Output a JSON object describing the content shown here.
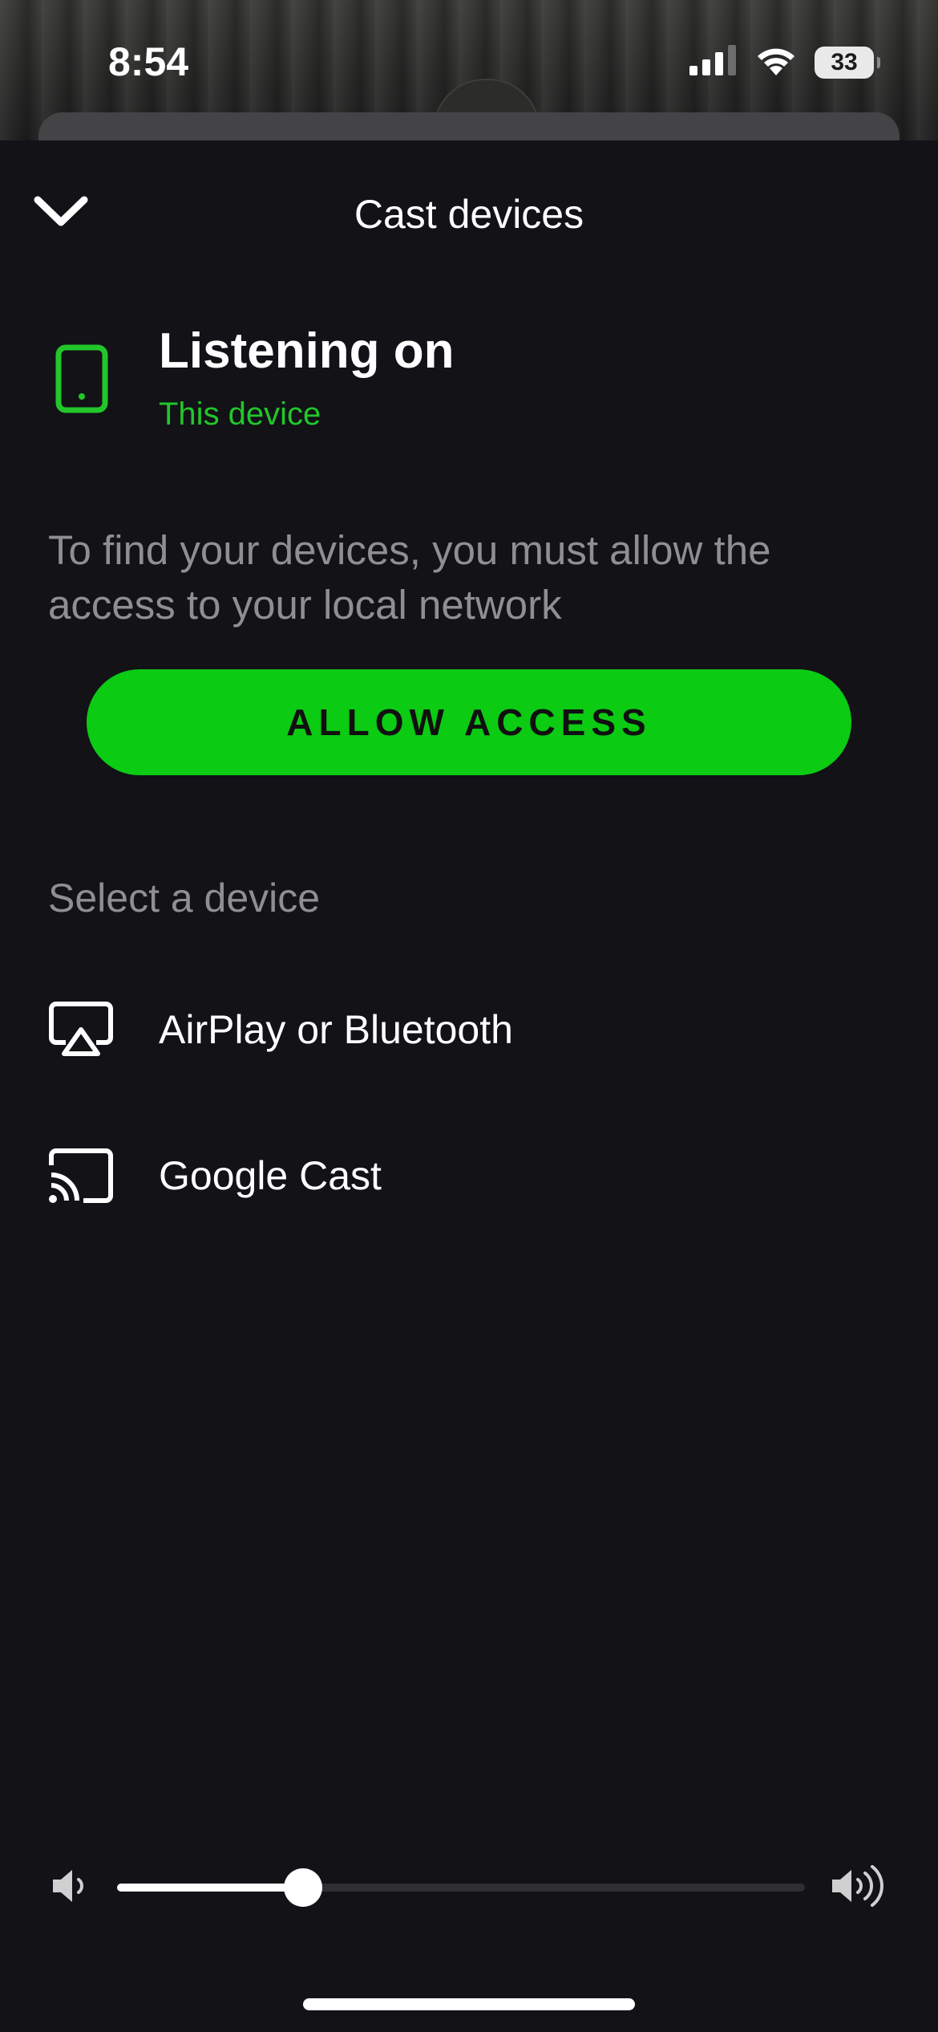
{
  "status_bar": {
    "time": "8:54",
    "battery": "33",
    "icons": [
      "cellular-signal-icon",
      "wifi-icon",
      "battery-icon"
    ]
  },
  "sheet": {
    "title": "Cast devices",
    "close_icon": "chevron-down-icon"
  },
  "current_device": {
    "title": "Listening on",
    "subtitle": "This device",
    "icon": "phone-icon",
    "accent_color": "#1ed760"
  },
  "local_network": {
    "message": "To find your devices, you must allow the access to your local network",
    "button_label": "ALLOW ACCESS",
    "button_color": "#0bcb13"
  },
  "select_device": {
    "label": "Select a device",
    "items": [
      {
        "label": "AirPlay or Bluetooth",
        "icon": "airplay-icon"
      },
      {
        "label": "Google Cast",
        "icon": "cast-icon"
      }
    ]
  },
  "volume": {
    "level": 0.27,
    "low_icon": "volume-low-icon",
    "high_icon": "volume-high-icon"
  }
}
